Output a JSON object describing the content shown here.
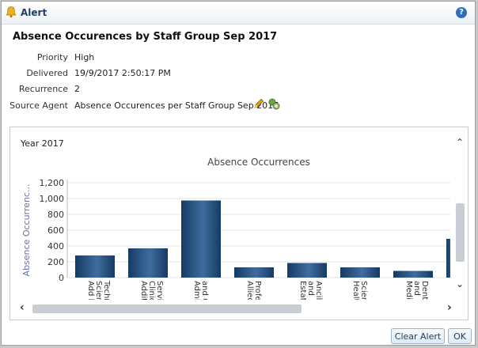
{
  "dialog": {
    "title": "Alert",
    "help_label": "?",
    "heading": "Absence Occurences by Staff Group Sep 2017"
  },
  "details": {
    "priority_label": "Priority",
    "priority_value": "High",
    "delivered_label": "Delivered",
    "delivered_value": "19/9/2017 2:50:17 PM",
    "recurrence_label": "Recurrence",
    "recurrence_value": "2",
    "source_agent_label": "Source Agent",
    "source_agent_value": "Absence Occurences per Staff Group Sep 2017"
  },
  "panel": {
    "year_label": "Year 2017"
  },
  "chart_data": {
    "type": "bar",
    "title": "Absence Occurrences",
    "ylabel": "Absence Occurrenc...",
    "xlabel": "",
    "ylim": [
      0,
      1200
    ],
    "yticks": [
      0,
      200,
      400,
      600,
      800,
      1000,
      1200
    ],
    "ytick_labels": [
      "0",
      "200",
      "400",
      "600",
      "800",
      "1,000",
      "1,200"
    ],
    "categories": [
      [
        "Add Pr",
        "Scient",
        "Techn"
      ],
      [
        "Additi",
        "Clinic",
        "Servic"
      ],
      [
        "Admin",
        "and Cl"
      ],
      [
        "Allied",
        "Profes"
      ],
      [
        "Estate",
        "and",
        "Ancilla"
      ],
      [
        "Health",
        "Scient"
      ],
      [
        "Medica",
        "and",
        "Dental"
      ]
    ],
    "values": [
      280,
      370,
      975,
      130,
      185,
      130,
      85
    ],
    "partial_last_value": 490,
    "bar_color": "#1f4a7a",
    "grid": true
  },
  "buttons": {
    "clear_alert": "Clear Alert",
    "ok": "OK"
  },
  "icons": {
    "bell": "bell-icon",
    "help": "help-icon",
    "pencil": "pencil-icon",
    "agent": "agent-icon"
  }
}
